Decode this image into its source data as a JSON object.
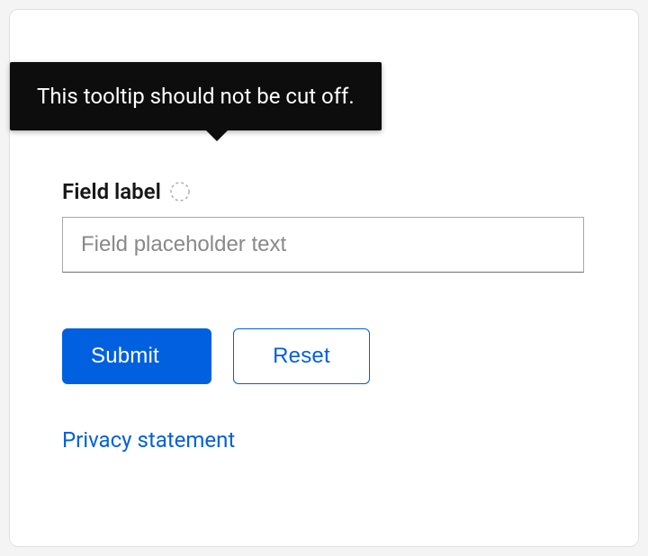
{
  "tooltip": {
    "text": "This tooltip should not be cut off."
  },
  "form": {
    "field_label": "Field label",
    "field_placeholder": "Field placeholder text",
    "submit_label": "Submit",
    "reset_label": "Reset",
    "privacy_link_label": "Privacy statement"
  }
}
